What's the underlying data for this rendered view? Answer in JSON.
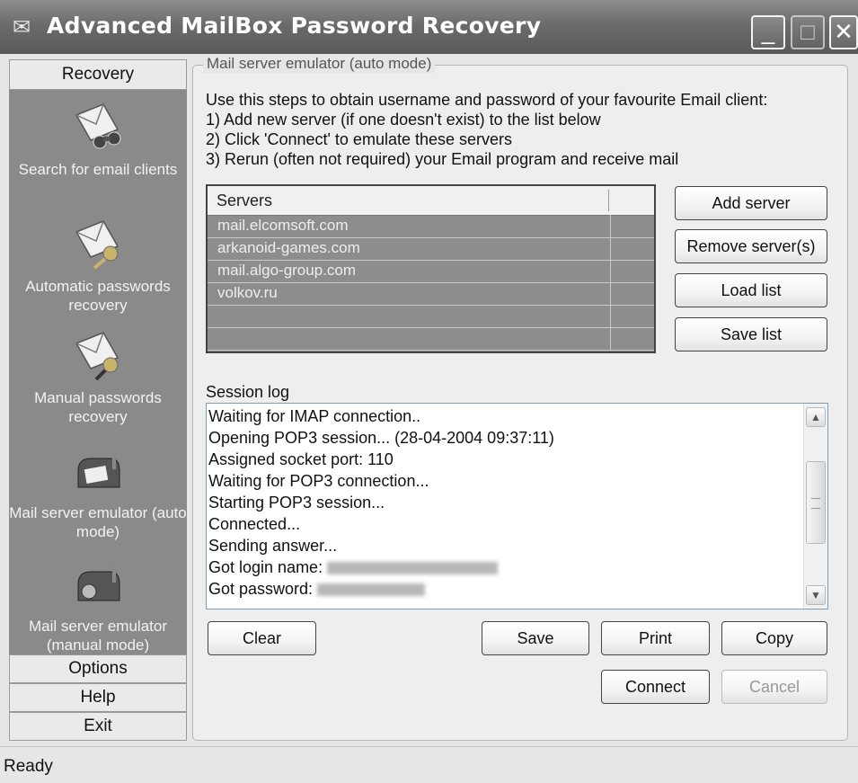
{
  "window": {
    "title": "Advanced MailBox Password Recovery",
    "controls": {
      "minimize": "_",
      "maximize": "□",
      "close": "✕"
    }
  },
  "sidebar": {
    "recovery_label": "Recovery",
    "items": [
      {
        "label": "Search for email clients",
        "icon": "envelope-binoculars-icon"
      },
      {
        "label": "Automatic passwords recovery",
        "icon": "envelope-key-icon"
      },
      {
        "label": "Manual passwords recovery",
        "icon": "envelope-key-icon"
      },
      {
        "label": "Mail server emulator (auto mode)",
        "icon": "mailbox-icon"
      },
      {
        "label": "Mail server emulator (manual mode)",
        "icon": "mailbox-icon"
      }
    ],
    "options_label": "Options",
    "help_label": "Help",
    "exit_label": "Exit"
  },
  "main": {
    "group_title": "Mail server emulator (auto mode)",
    "instructions": [
      "Use this steps to obtain username and password of your favourite Email client:",
      "1) Add new server (if one doesn't exist) to the list below",
      "2) Click 'Connect' to emulate these servers",
      "3) Rerun (often not required) your Email program and receive mail"
    ],
    "servers_header": "Servers",
    "servers": [
      "mail.elcomsoft.com",
      "arkanoid-games.com",
      "mail.algo-group.com",
      "volkov.ru"
    ],
    "buttons": {
      "add_server": "Add server",
      "remove_server": "Remove server(s)",
      "load_list": "Load list",
      "save_list": "Save list",
      "clear": "Clear",
      "save": "Save",
      "print": "Print",
      "copy": "Copy",
      "connect": "Connect",
      "cancel": "Cancel"
    },
    "log_label": "Session log",
    "log_lines": [
      "Waiting for IMAP connection..",
      "Opening POP3 session... (28-04-2004  09:37:11)",
      "Assigned socket port: 110",
      "Waiting for POP3 connection...",
      "Starting POP3 session...",
      "Connected...",
      "Sending answer...",
      "Got login name:",
      "Got password:"
    ]
  },
  "statusbar": {
    "text": "Ready"
  },
  "colors": {
    "title_bar": "#6b6b6b",
    "sidebar_panel": "#8a8a8a",
    "list_background": "#8d8d8d"
  }
}
